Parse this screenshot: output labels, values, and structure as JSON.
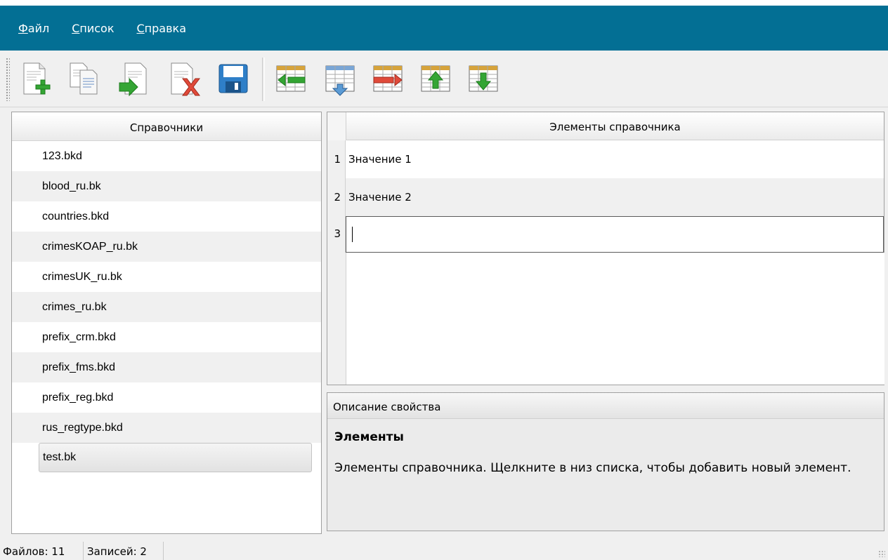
{
  "menu": [
    {
      "mnemonic": "Ф",
      "rest": "айл"
    },
    {
      "mnemonic": "С",
      "rest": "писок"
    },
    {
      "mnemonic": "С",
      "rest": "правка"
    }
  ],
  "toolbar_icons": [
    "new-file-icon",
    "copy-file-icon",
    "import-file-icon",
    "delete-file-icon",
    "save-icon",
    "insert-row-before-icon",
    "insert-row-below-icon",
    "delete-row-icon",
    "move-row-up-icon",
    "move-row-down-icon"
  ],
  "left_panel": {
    "header": "Справочники",
    "items": [
      "123.bkd",
      "blood_ru.bk",
      "countries.bkd",
      "crimesKOAP_ru.bk",
      "crimesUK_ru.bk",
      "crimes_ru.bk",
      "prefix_crm.bkd",
      "prefix_fms.bkd",
      "prefix_reg.bkd",
      "rus_regtype.bkd",
      "test.bk"
    ],
    "selected": "test.bk"
  },
  "elements_panel": {
    "header": "Элементы справочника",
    "rows": [
      {
        "num": "1",
        "value": "Значение 1"
      },
      {
        "num": "2",
        "value": "Значение 2"
      },
      {
        "num": "3",
        "value": ""
      }
    ]
  },
  "description_panel": {
    "header": "Описание свойства",
    "title": "Элементы",
    "text": "Элементы справочника. Щелкните в низ списка, чтобы добавить новый элемент."
  },
  "status": {
    "files": "Файлов: 11",
    "records": "Записей: 2"
  },
  "colors": {
    "menubar": "#036f94",
    "background": "#f0f0f0"
  }
}
